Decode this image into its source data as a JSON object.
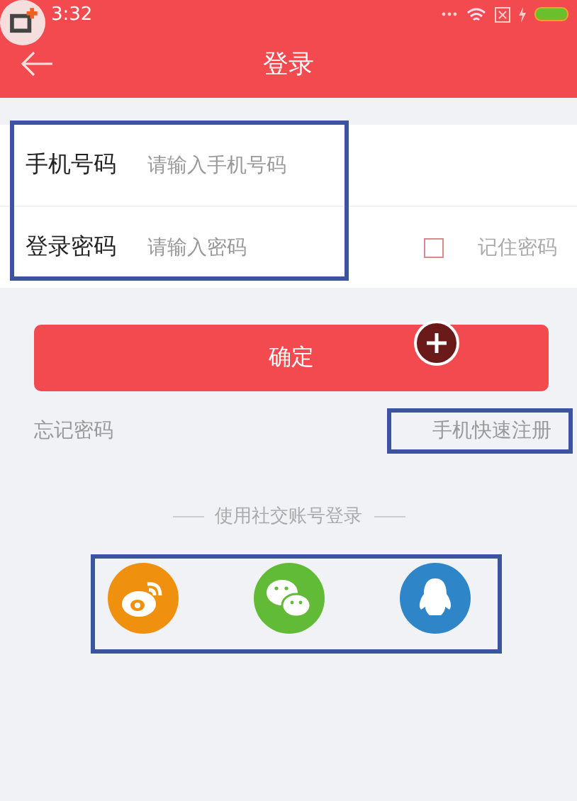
{
  "status_bar": {
    "time": "3:32"
  },
  "header": {
    "title": "登录"
  },
  "fields": [
    {
      "label": "手机号码",
      "placeholder": "请输入手机号码"
    },
    {
      "label": "登录密码",
      "placeholder": "请输入密码"
    }
  ],
  "remember": {
    "label": "记住密码",
    "checked": false
  },
  "submit": "确定",
  "links": {
    "forgot": "忘记密码",
    "register": "手机快速注册"
  },
  "social": {
    "heading": "使用社交账号登录",
    "providers": [
      {
        "kind": "weibo"
      },
      {
        "kind": "wechat"
      },
      {
        "kind": "qq"
      }
    ]
  }
}
